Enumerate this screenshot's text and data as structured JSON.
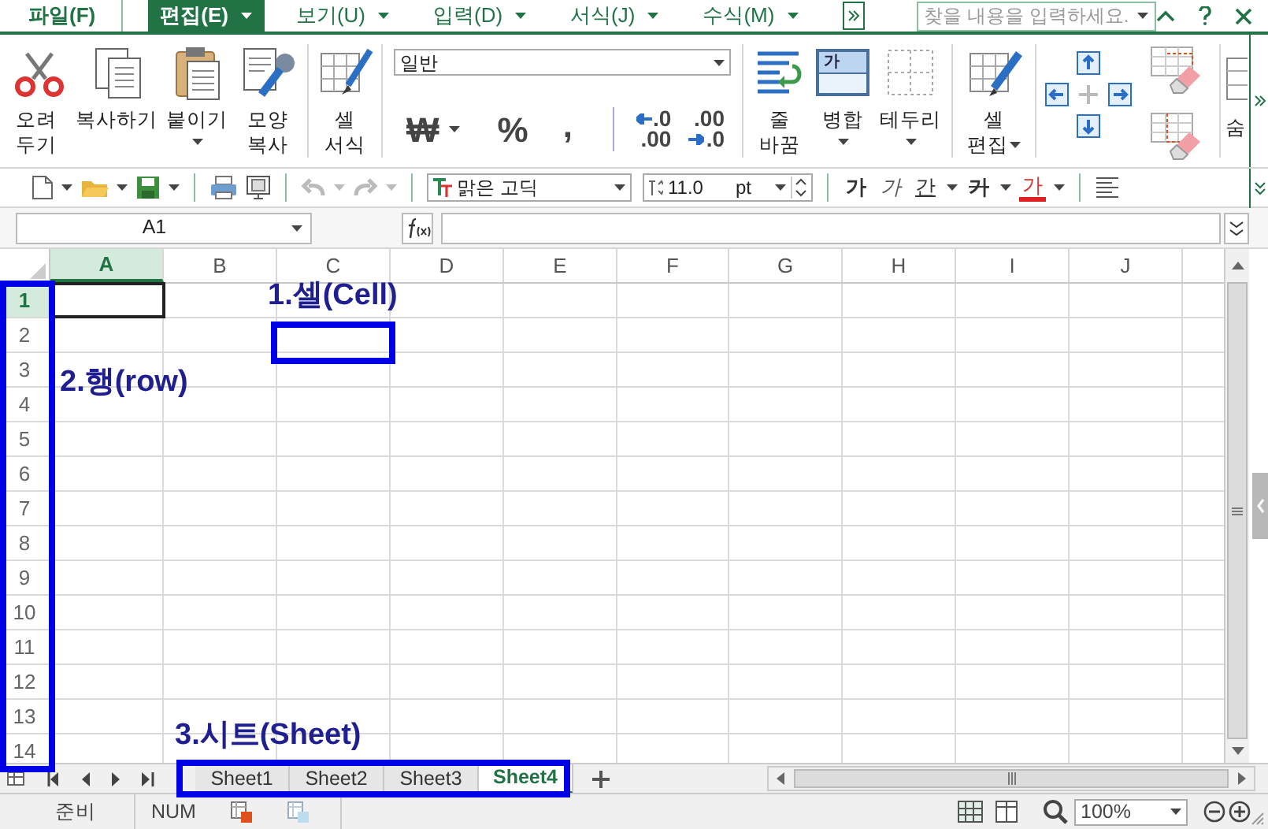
{
  "menu_bar": {
    "tabs": [
      {
        "label": "파일(F)",
        "selected": false,
        "has_dropdown": false
      },
      {
        "label": "편집(E)",
        "selected": true,
        "has_dropdown": true
      },
      {
        "label": "보기(U)",
        "selected": false,
        "has_dropdown": true
      },
      {
        "label": "입력(D)",
        "selected": false,
        "has_dropdown": true
      },
      {
        "label": "서식(J)",
        "selected": false,
        "has_dropdown": true
      },
      {
        "label": "수식(M)",
        "selected": false,
        "has_dropdown": true
      }
    ],
    "search": {
      "placeholder": "찾을 내용을 입력하세요."
    }
  },
  "ribbon": {
    "clipboard": [
      {
        "lines": [
          "오려",
          "두기"
        ],
        "dropdown": false
      },
      {
        "lines": [
          "복사하기"
        ],
        "dropdown": false
      },
      {
        "lines": [
          "붙이기"
        ],
        "dropdown": true
      },
      {
        "lines": [
          "모양",
          "복사"
        ],
        "dropdown": false
      }
    ],
    "format_cells": {
      "lines": [
        "셀",
        "서식"
      ]
    },
    "number": {
      "format": "일반",
      "currency": "₩",
      "percent": "%",
      "comma": ",",
      "increase_decimal": [
        ".0",
        ".00"
      ],
      "decrease_decimal": [
        ".00",
        ".0"
      ]
    },
    "alignment": [
      {
        "lines": [
          "줄",
          "바꿈"
        ],
        "dropdown": false
      },
      {
        "lines": [
          "병합"
        ],
        "dropdown": true,
        "icon_text": "가"
      },
      {
        "lines": [
          "테두리"
        ],
        "dropdown": true
      }
    ],
    "edit_cells": {
      "lines": [
        "셀",
        "편집"
      ],
      "dropdown": true
    },
    "cut_off_label": "숨"
  },
  "toolbar": {
    "font": "맑은 고딕",
    "size": "11.0",
    "unit": "pt",
    "bold": "가",
    "italic": "가",
    "underline": "간",
    "strikethrough": "가",
    "font_color": "가"
  },
  "formula_bar": {
    "name_box": "A1"
  },
  "sheet": {
    "columns": [
      {
        "label": "A",
        "selected": true
      },
      {
        "label": "B",
        "selected": false
      },
      {
        "label": "C",
        "selected": false
      },
      {
        "label": "D",
        "selected": false
      },
      {
        "label": "E",
        "selected": false
      },
      {
        "label": "F",
        "selected": false
      },
      {
        "label": "G",
        "selected": false
      },
      {
        "label": "H",
        "selected": false
      },
      {
        "label": "I",
        "selected": false
      },
      {
        "label": "J",
        "selected": false
      }
    ],
    "rows": [
      {
        "label": "1",
        "selected": true
      },
      {
        "label": "2",
        "selected": false
      },
      {
        "label": "3",
        "selected": false
      },
      {
        "label": "4",
        "selected": false
      },
      {
        "label": "5",
        "selected": false
      },
      {
        "label": "6",
        "selected": false
      },
      {
        "label": "7",
        "selected": false
      },
      {
        "label": "8",
        "selected": false
      },
      {
        "label": "9",
        "selected": false
      },
      {
        "label": "10",
        "selected": false
      },
      {
        "label": "11",
        "selected": false
      },
      {
        "label": "12",
        "selected": false
      },
      {
        "label": "13",
        "selected": false
      },
      {
        "label": "14",
        "selected": false
      }
    ]
  },
  "sheet_tabs": [
    {
      "label": "Sheet1",
      "selected": false
    },
    {
      "label": "Sheet2",
      "selected": false
    },
    {
      "label": "Sheet3",
      "selected": false
    },
    {
      "label": "Sheet4",
      "selected": true
    }
  ],
  "annotations": [
    {
      "kind": "cell",
      "text": "1.셀(Cell)"
    },
    {
      "kind": "row_headers",
      "text": "2.행(row)"
    },
    {
      "kind": "sheet_tabs",
      "text": "3.시트(Sheet)"
    }
  ],
  "status_bar": {
    "mode": "준비",
    "num_lock": "NUM",
    "zoom": "100%"
  }
}
